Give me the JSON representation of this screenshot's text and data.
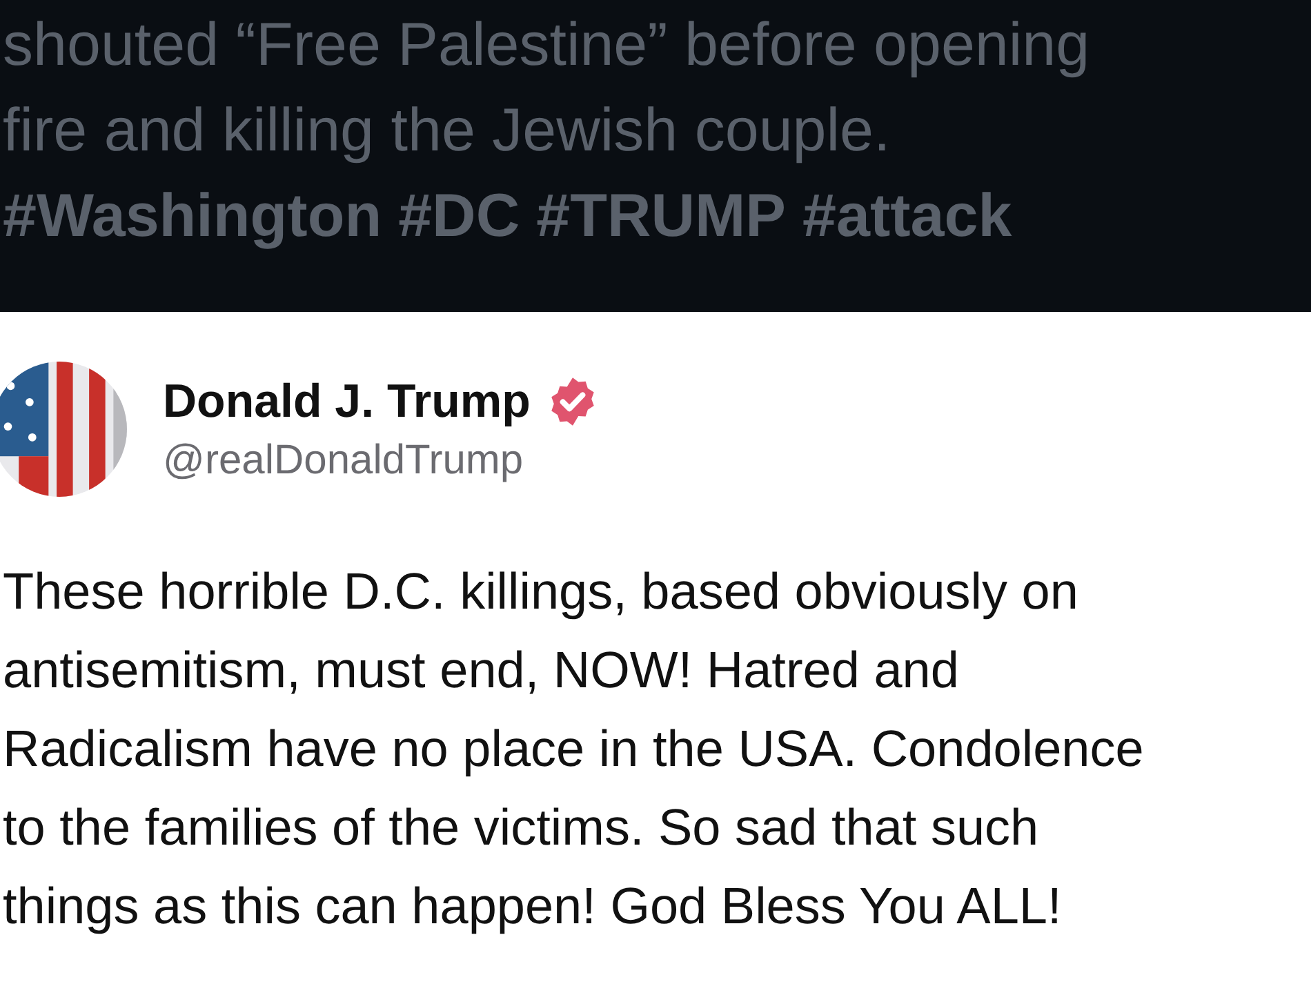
{
  "quoted_post": {
    "lines": [
      "shouted “Free Palestine” before opening",
      "fire and killing the Jewish couple."
    ],
    "hashtags": [
      "#Washington",
      "#DC",
      "#TRUMP",
      "#attack"
    ]
  },
  "post": {
    "author": {
      "name": "Donald J. Trump",
      "verified": true,
      "handle": "@realDonaldTrump"
    },
    "lines": [
      "These horrible D.C. killings, based obviously on",
      "antisemitism, must end, NOW! Hatred and",
      "Radicalism have no place in the USA. Condolence",
      "to the families of the victims. So sad that such",
      "things as this can happen! God Bless You ALL!"
    ]
  }
}
